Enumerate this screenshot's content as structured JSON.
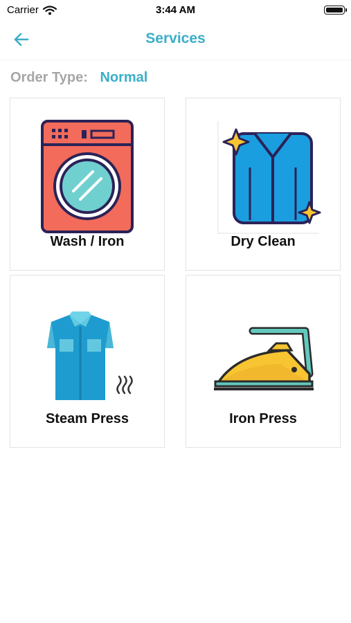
{
  "status_bar": {
    "carrier": "Carrier",
    "time": "3:44 AM"
  },
  "nav": {
    "title": "Services",
    "back_icon": "arrow-left-icon"
  },
  "order": {
    "label": "Order Type:",
    "value": "Normal"
  },
  "services": [
    {
      "label": "Wash / Iron",
      "icon": "washing-machine-icon"
    },
    {
      "label": "Dry Clean",
      "icon": "dry-clean-shirt-icon"
    },
    {
      "label": "Steam Press",
      "icon": "steamed-shirt-icon"
    },
    {
      "label": "Iron Press",
      "icon": "clothes-iron-icon"
    }
  ],
  "colors": {
    "accent": "#3aaec9",
    "muted_label": "#a6a6a6",
    "card_border": "#e3e3e3"
  }
}
